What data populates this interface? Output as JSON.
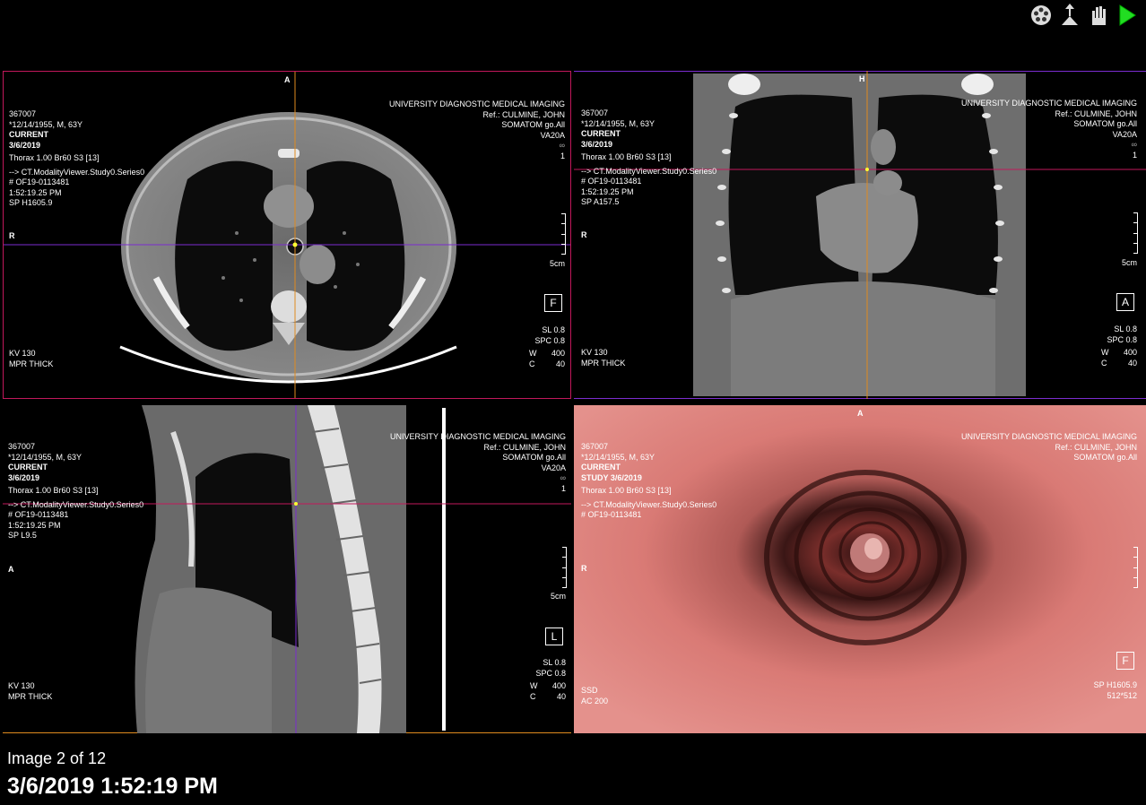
{
  "toolbar": {
    "icons": [
      "film-reel-icon",
      "patient-upload-icon",
      "hand-tool-icon",
      "play-icon"
    ]
  },
  "common": {
    "patient_id": "367007",
    "dob_line": "*12/14/1955, M, 63Y",
    "current": "CURRENT",
    "date": "3/6/2019",
    "series": "Thorax  1.00  Br60  S3 [13]",
    "modality_viewer": "--> CT.ModalityViewer.Study0.Series0",
    "accession": "# OF19-0113481",
    "institution": "UNIVERSITY DIAGNOSTIC MEDICAL IMAGING",
    "referrer": "Ref.: CULMINE, JOHN",
    "scanner": "SOMATOM go.All",
    "station": "VA20A",
    "scale_label": "5cm",
    "kv": "KV 130",
    "mpr": "MPR THICK",
    "sl": "SL 0.8",
    "spc": "SPC 0.8",
    "w_label": "W",
    "w_value": "400",
    "c_label": "C",
    "c_value": "40",
    "link_number": "1"
  },
  "viewports": {
    "axial": {
      "time": "1:52:19.25 PM",
      "position": "SP H1605.9",
      "top_orient": "A",
      "left_orient": "R",
      "badge": "F"
    },
    "coronal": {
      "time": "1:52:19.25 PM",
      "position": "SP A157.5",
      "top_orient": "H",
      "left_orient": "R",
      "badge": "A"
    },
    "sagittal": {
      "time": "1:52:19.25 PM",
      "position": "SP L9.5",
      "left_orient": "A",
      "badge": "L"
    },
    "endoscopy": {
      "study_line": "STUDY 3/6/2019",
      "accession": "# OF19-0113481",
      "top_orient": "A",
      "left_orient": "R",
      "badge": "F",
      "render_mode": "SSD",
      "ac": "AC 200",
      "position": "SP H1605.9",
      "matrix": "512*512",
      "bg_color": "#d97a75"
    }
  },
  "status": {
    "image_count": "Image 2 of 12",
    "timestamp": "3/6/2019 1:52:19 PM"
  },
  "colors": {
    "active_border": "#c2185b",
    "crosshair_orange": "#e08a1e",
    "crosshair_purple": "#7b2ccf",
    "crosshair_magenta": "#c2185b"
  }
}
